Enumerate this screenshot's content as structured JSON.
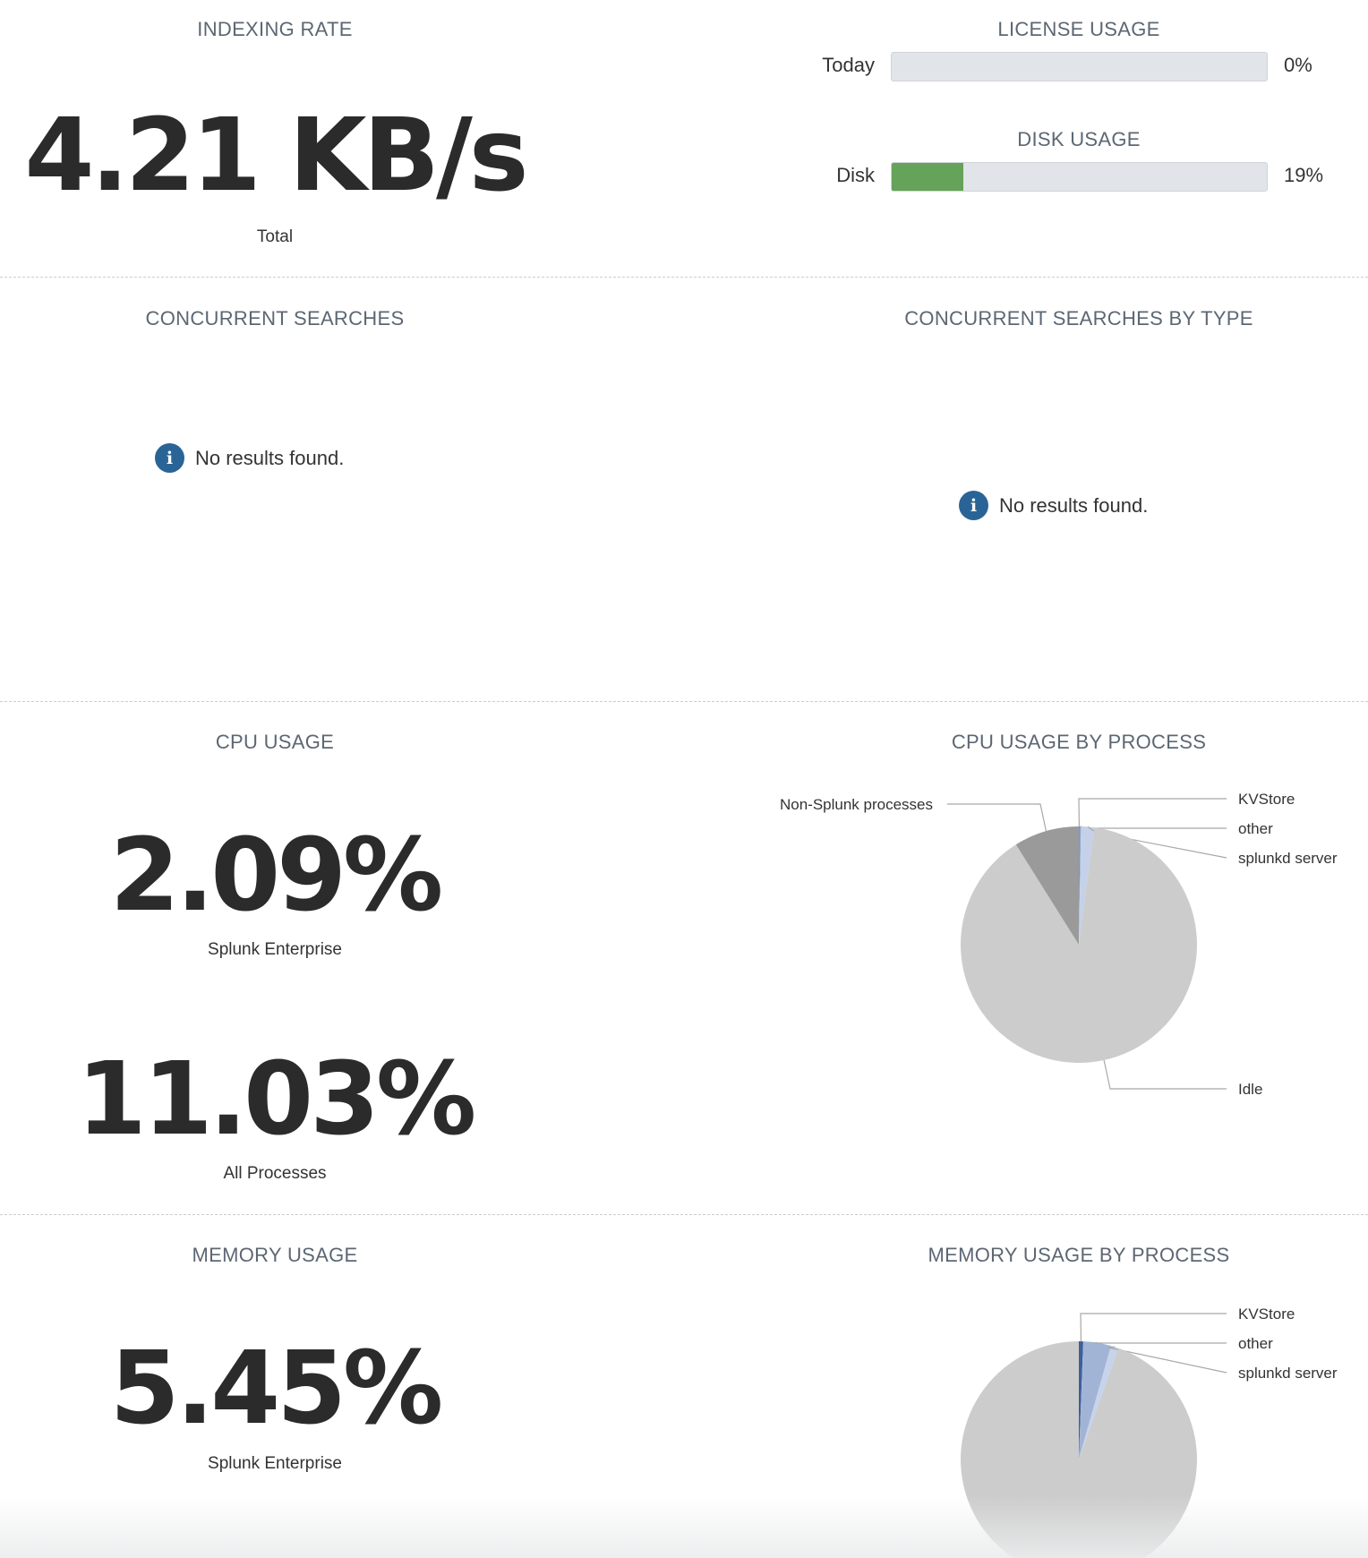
{
  "indexing": {
    "title": "INDEXING RATE",
    "value": "4.21 KB/s",
    "caption": "Total"
  },
  "license": {
    "title": "LICENSE USAGE",
    "label": "Today",
    "percent_text": "0%",
    "fraction": 0.0
  },
  "disk": {
    "title": "DISK USAGE",
    "label": "Disk",
    "percent_text": "19%",
    "fraction": 0.19,
    "fill_color": "#65a25a"
  },
  "concurrent": {
    "title": "CONCURRENT SEARCHES",
    "message": "No results found."
  },
  "concurrent_by_type": {
    "title": "CONCURRENT SEARCHES BY TYPE",
    "message": "No results found."
  },
  "cpu": {
    "title": "CPU USAGE",
    "splunk_value": "2.09%",
    "splunk_caption": "Splunk Enterprise",
    "all_value": "11.03%",
    "all_caption": "All Processes"
  },
  "memory": {
    "title": "MEMORY USAGE",
    "splunk_value": "5.45%",
    "splunk_caption": "Splunk Enterprise"
  },
  "chart_data": [
    {
      "type": "pie",
      "title": "CPU USAGE BY PROCESS",
      "slices": [
        {
          "label": "KVStore",
          "value": 0.1,
          "color": "#5b7fb5"
        },
        {
          "label": "other",
          "value": 0.2,
          "color": "#8aa7d4"
        },
        {
          "label": "splunkd server",
          "value": 1.8,
          "color": "#c4d1e8"
        },
        {
          "label": "Idle",
          "value": 88.97,
          "color": "#cccccc"
        },
        {
          "label": "Non-Splunk processes",
          "value": 8.93,
          "color": "#9a9a9a"
        }
      ]
    },
    {
      "type": "pie",
      "title": "MEMORY USAGE BY PROCESS",
      "slices": [
        {
          "label": "KVStore",
          "value": 0.6,
          "color": "#3d5f9a"
        },
        {
          "label": "other",
          "value": 3.8,
          "color": "#a2b4d6"
        },
        {
          "label": "splunkd server",
          "value": 1.05,
          "color": "#c6d3ea"
        },
        {
          "label": "",
          "value": 94.55,
          "color": "#cccccc"
        }
      ]
    }
  ]
}
